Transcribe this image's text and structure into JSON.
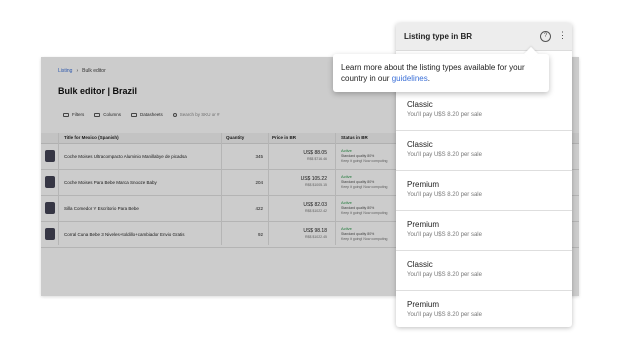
{
  "breadcrumb": {
    "link": "Listing",
    "separator": "›",
    "current": "Bulk editor"
  },
  "page_title": "Bulk editor | Brazil",
  "toolbar": {
    "filters": "Filters",
    "columns": "Columns",
    "datasheets": "Datasheets",
    "search_placeholder": "Search by SKU or #"
  },
  "table": {
    "headers": {
      "title": "Title for Mexico (Spanish)",
      "quantity": "Quantity",
      "price": "Price in BR",
      "status": "Status in BR"
    },
    "rows": [
      {
        "title": "Coche Moises Ultracompacto Aluminio Manillabye de picadsa",
        "quantity": "345",
        "price": "US$ 88.05",
        "price_sub": "R$$ $716.46",
        "status": "Active",
        "quality": "Standard quality 80%",
        "note": "Keep it going! Now computing"
      },
      {
        "title": "Coche Moises Para Bebe Marca Snooze Baby",
        "quantity": "204",
        "price": "US$ 105.22",
        "price_sub": "R$$ $1005.15",
        "status": "Active",
        "quality": "Standard quality 80%",
        "note": "Keep it going! Now computing"
      },
      {
        "title": "Silla Comedor Y Escritorio Para Bebe",
        "quantity": "422",
        "price": "US$ 82.03",
        "price_sub": "R$$ $1022.42",
        "status": "Active",
        "quality": "Standard quality 80%",
        "note": "Keep it going! Now computing"
      },
      {
        "title": "Corral Cuna Bebe 3 Niveles+toldillo+cambiador Envio Gratis",
        "quantity": "92",
        "price": "US$ 98.18",
        "price_sub": "R$$ $1022.45",
        "status": "Active",
        "quality": "Standard quality 80%",
        "note": "Keep it going! Now computing"
      }
    ]
  },
  "dropdown": {
    "title": "Listing type in BR",
    "help_icon": "?",
    "more_icon": "⋮",
    "tooltip": {
      "text": "Learn more about the listing types available for your country in our ",
      "link": "guidelines",
      "suffix": "."
    },
    "options": [
      {
        "name": "Classic",
        "price": "You'll pay U$S 8.20 per sale"
      },
      {
        "name": "Classic",
        "price": "You'll pay U$S 8.20 per sale"
      },
      {
        "name": "Premium",
        "price": "You'll pay U$S 8.20 per sale"
      },
      {
        "name": "Premium",
        "price": "You'll pay U$S 8.20 per sale"
      },
      {
        "name": "Classic",
        "price": "You'll pay U$S 8.20 per sale"
      },
      {
        "name": "Premium",
        "price": "You'll pay U$S 8.20 per sale"
      }
    ]
  },
  "colors": {
    "accent": "#3a6fd8",
    "status_active": "#2a9a4a",
    "overlay": "rgba(0,0,0,0.2)"
  }
}
